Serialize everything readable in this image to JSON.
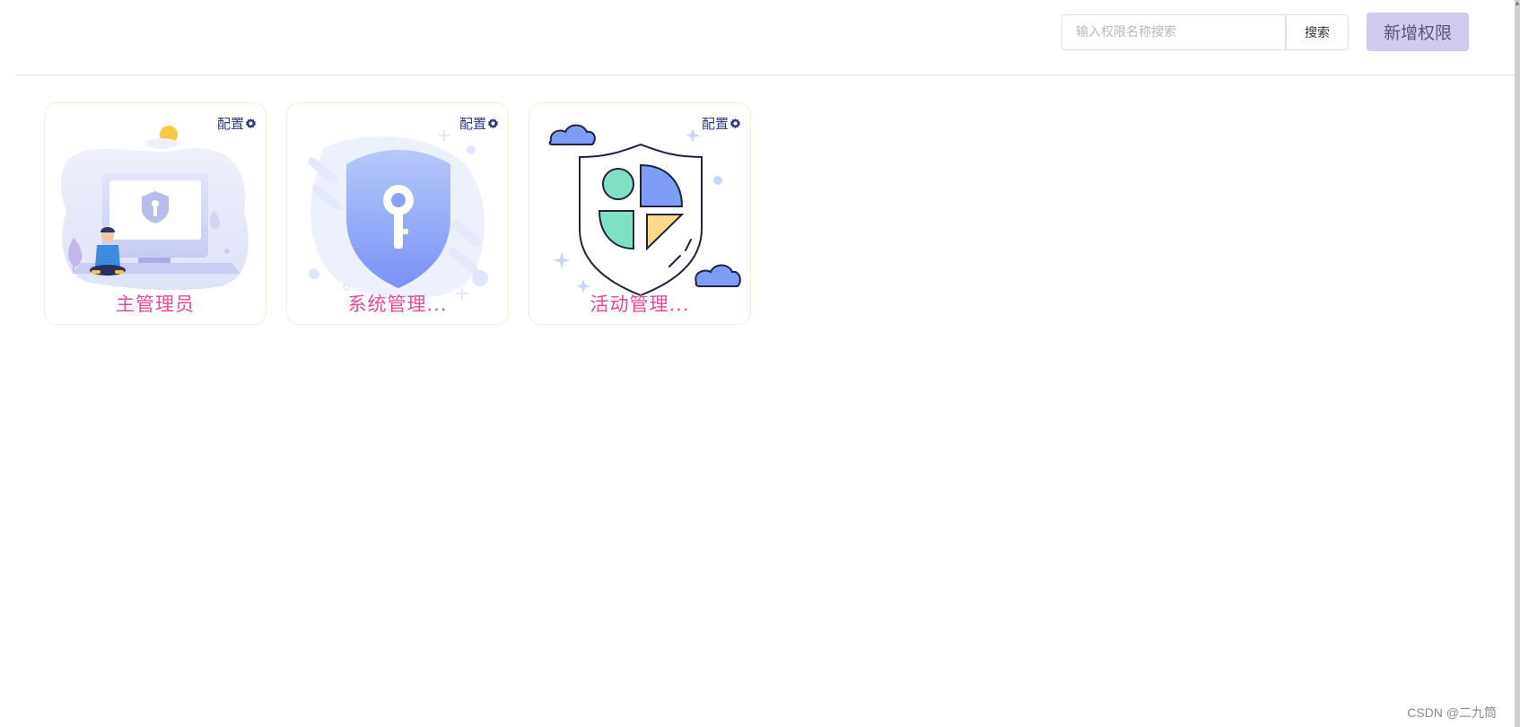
{
  "toolbar": {
    "search_placeholder": "输入权限名称搜索",
    "search_button": "搜索",
    "add_button": "新增权限"
  },
  "cards": [
    {
      "title": "主管理员",
      "config_label": "配置",
      "icon": "laptop-security-illustration"
    },
    {
      "title": "系统管理...",
      "config_label": "配置",
      "icon": "shield-key-illustration"
    },
    {
      "title": "活动管理...",
      "config_label": "配置",
      "icon": "shield-chart-illustration"
    }
  ],
  "watermark": "CSDN @二九筒",
  "colors": {
    "title": "#e8479e",
    "config": "#2e3a7a",
    "add_button_bg": "#cfccee",
    "accent_blue": "#7f9ef9"
  }
}
